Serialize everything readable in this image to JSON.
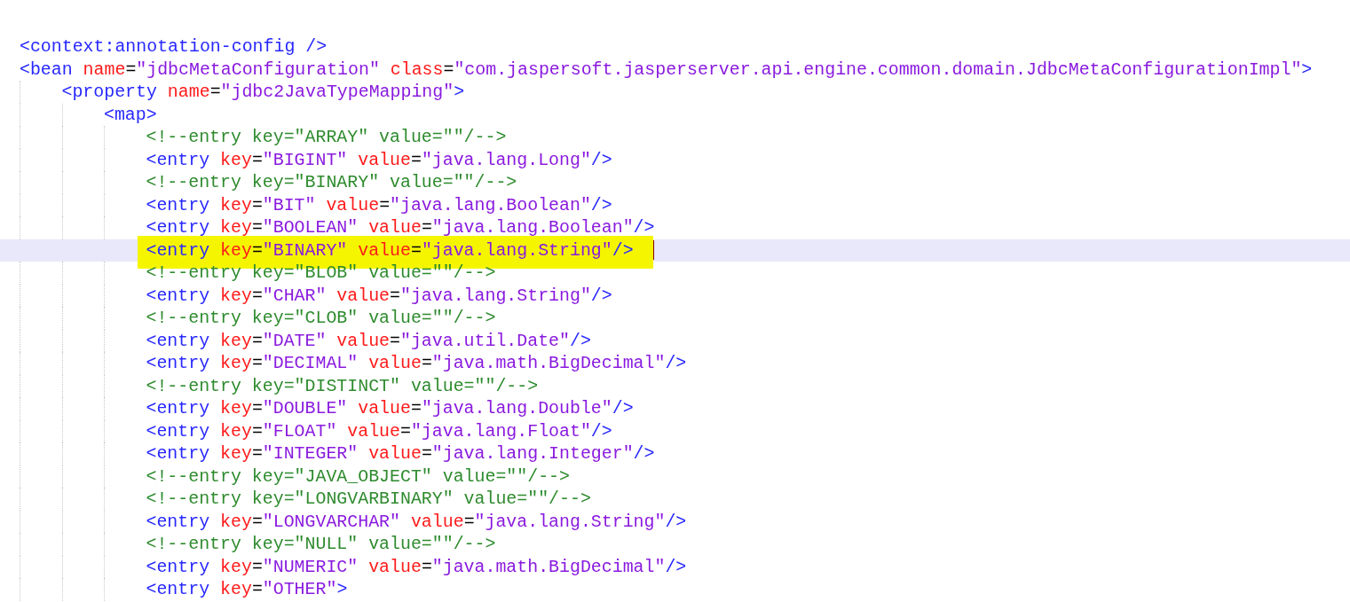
{
  "editor": {
    "lines": [
      {
        "tokens": [
          {
            "kind": "tag",
            "text": "<context:annotation-config />"
          }
        ],
        "current": false,
        "marked": false
      },
      {
        "tokens": [
          {
            "kind": "tag",
            "text": "<bean"
          },
          {
            "kind": "attr",
            "text": " name"
          },
          {
            "kind": "eq",
            "text": "="
          },
          {
            "kind": "val",
            "text": "\"jdbcMetaConfiguration\""
          },
          {
            "kind": "attr",
            "text": " class"
          },
          {
            "kind": "eq",
            "text": "="
          },
          {
            "kind": "val",
            "text": "\"com.jaspersoft.jasperserver.api.engine.common.domain.JdbcMetaConfigurationImpl\""
          },
          {
            "kind": "tag",
            "text": ">"
          }
        ],
        "current": false,
        "marked": false,
        "children": [
          {
            "tokens": [
              {
                "kind": "tag",
                "text": "<property"
              },
              {
                "kind": "attr",
                "text": " name"
              },
              {
                "kind": "eq",
                "text": "="
              },
              {
                "kind": "val",
                "text": "\"jdbc2JavaTypeMapping\""
              },
              {
                "kind": "tag",
                "text": ">"
              }
            ],
            "current": false,
            "marked": false,
            "children": [
              {
                "tokens": [
                  {
                    "kind": "tag",
                    "text": "<map>"
                  }
                ],
                "current": false,
                "marked": false,
                "children": [
                  {
                    "tokens": [
                      {
                        "kind": "comment",
                        "text": "<!--entry key=\"ARRAY\" value=\"\"/-->"
                      }
                    ],
                    "current": false,
                    "marked": false
                  },
                  {
                    "tokens": [
                      {
                        "kind": "tag",
                        "text": "<entry"
                      },
                      {
                        "kind": "attr",
                        "text": " key"
                      },
                      {
                        "kind": "eq",
                        "text": "="
                      },
                      {
                        "kind": "val",
                        "text": "\"BIGINT\""
                      },
                      {
                        "kind": "attr",
                        "text": " value"
                      },
                      {
                        "kind": "eq",
                        "text": "="
                      },
                      {
                        "kind": "val",
                        "text": "\"java.lang.Long\""
                      },
                      {
                        "kind": "tag",
                        "text": "/>"
                      }
                    ],
                    "current": false,
                    "marked": false
                  },
                  {
                    "tokens": [
                      {
                        "kind": "comment",
                        "text": "<!--entry key=\"BINARY\" value=\"\"/-->"
                      }
                    ],
                    "current": false,
                    "marked": false
                  },
                  {
                    "tokens": [
                      {
                        "kind": "tag",
                        "text": "<entry"
                      },
                      {
                        "kind": "attr",
                        "text": " key"
                      },
                      {
                        "kind": "eq",
                        "text": "="
                      },
                      {
                        "kind": "val",
                        "text": "\"BIT\""
                      },
                      {
                        "kind": "attr",
                        "text": " value"
                      },
                      {
                        "kind": "eq",
                        "text": "="
                      },
                      {
                        "kind": "val",
                        "text": "\"java.lang.Boolean\""
                      },
                      {
                        "kind": "tag",
                        "text": "/>"
                      }
                    ],
                    "current": false,
                    "marked": false
                  },
                  {
                    "tokens": [
                      {
                        "kind": "tag",
                        "text": "<entry"
                      },
                      {
                        "kind": "attr",
                        "text": " key"
                      },
                      {
                        "kind": "eq",
                        "text": "="
                      },
                      {
                        "kind": "val",
                        "text": "\"BOOLEAN\""
                      },
                      {
                        "kind": "attr",
                        "text": " value"
                      },
                      {
                        "kind": "eq",
                        "text": "="
                      },
                      {
                        "kind": "val",
                        "text": "\"java.lang.Boolean\""
                      },
                      {
                        "kind": "tag",
                        "text": "/>"
                      }
                    ],
                    "current": false,
                    "marked": false
                  },
                  {
                    "tokens": [
                      {
                        "kind": "tag",
                        "text": "<entry"
                      },
                      {
                        "kind": "attr",
                        "text": " key"
                      },
                      {
                        "kind": "eq",
                        "text": "="
                      },
                      {
                        "kind": "val",
                        "text": "\"BINARY\""
                      },
                      {
                        "kind": "attr",
                        "text": " value"
                      },
                      {
                        "kind": "eq",
                        "text": "="
                      },
                      {
                        "kind": "val",
                        "text": "\"java.lang.String\""
                      },
                      {
                        "kind": "tag",
                        "text": "/>"
                      }
                    ],
                    "current": true,
                    "marked": true
                  },
                  {
                    "tokens": [
                      {
                        "kind": "comment",
                        "text": "<!--entry key=\"BLOB\" value=\"\"/-->"
                      }
                    ],
                    "current": false,
                    "marked": false
                  },
                  {
                    "tokens": [
                      {
                        "kind": "tag",
                        "text": "<entry"
                      },
                      {
                        "kind": "attr",
                        "text": " key"
                      },
                      {
                        "kind": "eq",
                        "text": "="
                      },
                      {
                        "kind": "val",
                        "text": "\"CHAR\""
                      },
                      {
                        "kind": "attr",
                        "text": " value"
                      },
                      {
                        "kind": "eq",
                        "text": "="
                      },
                      {
                        "kind": "val",
                        "text": "\"java.lang.String\""
                      },
                      {
                        "kind": "tag",
                        "text": "/>"
                      }
                    ],
                    "current": false,
                    "marked": false
                  },
                  {
                    "tokens": [
                      {
                        "kind": "comment",
                        "text": "<!--entry key=\"CLOB\" value=\"\"/-->"
                      }
                    ],
                    "current": false,
                    "marked": false
                  },
                  {
                    "tokens": [
                      {
                        "kind": "tag",
                        "text": "<entry"
                      },
                      {
                        "kind": "attr",
                        "text": " key"
                      },
                      {
                        "kind": "eq",
                        "text": "="
                      },
                      {
                        "kind": "val",
                        "text": "\"DATE\""
                      },
                      {
                        "kind": "attr",
                        "text": " value"
                      },
                      {
                        "kind": "eq",
                        "text": "="
                      },
                      {
                        "kind": "val",
                        "text": "\"java.util.Date\""
                      },
                      {
                        "kind": "tag",
                        "text": "/>"
                      }
                    ],
                    "current": false,
                    "marked": false
                  },
                  {
                    "tokens": [
                      {
                        "kind": "tag",
                        "text": "<entry"
                      },
                      {
                        "kind": "attr",
                        "text": " key"
                      },
                      {
                        "kind": "eq",
                        "text": "="
                      },
                      {
                        "kind": "val",
                        "text": "\"DECIMAL\""
                      },
                      {
                        "kind": "attr",
                        "text": " value"
                      },
                      {
                        "kind": "eq",
                        "text": "="
                      },
                      {
                        "kind": "val",
                        "text": "\"java.math.BigDecimal\""
                      },
                      {
                        "kind": "tag",
                        "text": "/>"
                      }
                    ],
                    "current": false,
                    "marked": false
                  },
                  {
                    "tokens": [
                      {
                        "kind": "comment",
                        "text": "<!--entry key=\"DISTINCT\" value=\"\"/-->"
                      }
                    ],
                    "current": false,
                    "marked": false
                  },
                  {
                    "tokens": [
                      {
                        "kind": "tag",
                        "text": "<entry"
                      },
                      {
                        "kind": "attr",
                        "text": " key"
                      },
                      {
                        "kind": "eq",
                        "text": "="
                      },
                      {
                        "kind": "val",
                        "text": "\"DOUBLE\""
                      },
                      {
                        "kind": "attr",
                        "text": " value"
                      },
                      {
                        "kind": "eq",
                        "text": "="
                      },
                      {
                        "kind": "val",
                        "text": "\"java.lang.Double\""
                      },
                      {
                        "kind": "tag",
                        "text": "/>"
                      }
                    ],
                    "current": false,
                    "marked": false
                  },
                  {
                    "tokens": [
                      {
                        "kind": "tag",
                        "text": "<entry"
                      },
                      {
                        "kind": "attr",
                        "text": " key"
                      },
                      {
                        "kind": "eq",
                        "text": "="
                      },
                      {
                        "kind": "val",
                        "text": "\"FLOAT\""
                      },
                      {
                        "kind": "attr",
                        "text": " value"
                      },
                      {
                        "kind": "eq",
                        "text": "="
                      },
                      {
                        "kind": "val",
                        "text": "\"java.lang.Float\""
                      },
                      {
                        "kind": "tag",
                        "text": "/>"
                      }
                    ],
                    "current": false,
                    "marked": false
                  },
                  {
                    "tokens": [
                      {
                        "kind": "tag",
                        "text": "<entry"
                      },
                      {
                        "kind": "attr",
                        "text": " key"
                      },
                      {
                        "kind": "eq",
                        "text": "="
                      },
                      {
                        "kind": "val",
                        "text": "\"INTEGER\""
                      },
                      {
                        "kind": "attr",
                        "text": " value"
                      },
                      {
                        "kind": "eq",
                        "text": "="
                      },
                      {
                        "kind": "val",
                        "text": "\"java.lang.Integer\""
                      },
                      {
                        "kind": "tag",
                        "text": "/>"
                      }
                    ],
                    "current": false,
                    "marked": false
                  },
                  {
                    "tokens": [
                      {
                        "kind": "comment",
                        "text": "<!--entry key=\"JAVA_OBJECT\" value=\"\"/-->"
                      }
                    ],
                    "current": false,
                    "marked": false
                  },
                  {
                    "tokens": [
                      {
                        "kind": "comment",
                        "text": "<!--entry key=\"LONGVARBINARY\" value=\"\"/-->"
                      }
                    ],
                    "current": false,
                    "marked": false
                  },
                  {
                    "tokens": [
                      {
                        "kind": "tag",
                        "text": "<entry"
                      },
                      {
                        "kind": "attr",
                        "text": " key"
                      },
                      {
                        "kind": "eq",
                        "text": "="
                      },
                      {
                        "kind": "val",
                        "text": "\"LONGVARCHAR\""
                      },
                      {
                        "kind": "attr",
                        "text": " value"
                      },
                      {
                        "kind": "eq",
                        "text": "="
                      },
                      {
                        "kind": "val",
                        "text": "\"java.lang.String\""
                      },
                      {
                        "kind": "tag",
                        "text": "/>"
                      }
                    ],
                    "current": false,
                    "marked": false
                  },
                  {
                    "tokens": [
                      {
                        "kind": "comment",
                        "text": "<!--entry key=\"NULL\" value=\"\"/-->"
                      }
                    ],
                    "current": false,
                    "marked": false
                  },
                  {
                    "tokens": [
                      {
                        "kind": "tag",
                        "text": "<entry"
                      },
                      {
                        "kind": "attr",
                        "text": " key"
                      },
                      {
                        "kind": "eq",
                        "text": "="
                      },
                      {
                        "kind": "val",
                        "text": "\"NUMERIC\""
                      },
                      {
                        "kind": "attr",
                        "text": " value"
                      },
                      {
                        "kind": "eq",
                        "text": "="
                      },
                      {
                        "kind": "val",
                        "text": "\"java.math.BigDecimal\""
                      },
                      {
                        "kind": "tag",
                        "text": "/>"
                      }
                    ],
                    "current": false,
                    "marked": false
                  },
                  {
                    "tokens": [
                      {
                        "kind": "tag",
                        "text": "<entry"
                      },
                      {
                        "kind": "attr",
                        "text": " key"
                      },
                      {
                        "kind": "eq",
                        "text": "="
                      },
                      {
                        "kind": "val",
                        "text": "\"OTHER\""
                      },
                      {
                        "kind": "tag",
                        "text": ">"
                      }
                    ],
                    "current": false,
                    "marked": false
                  }
                ]
              }
            ]
          }
        ]
      }
    ]
  }
}
